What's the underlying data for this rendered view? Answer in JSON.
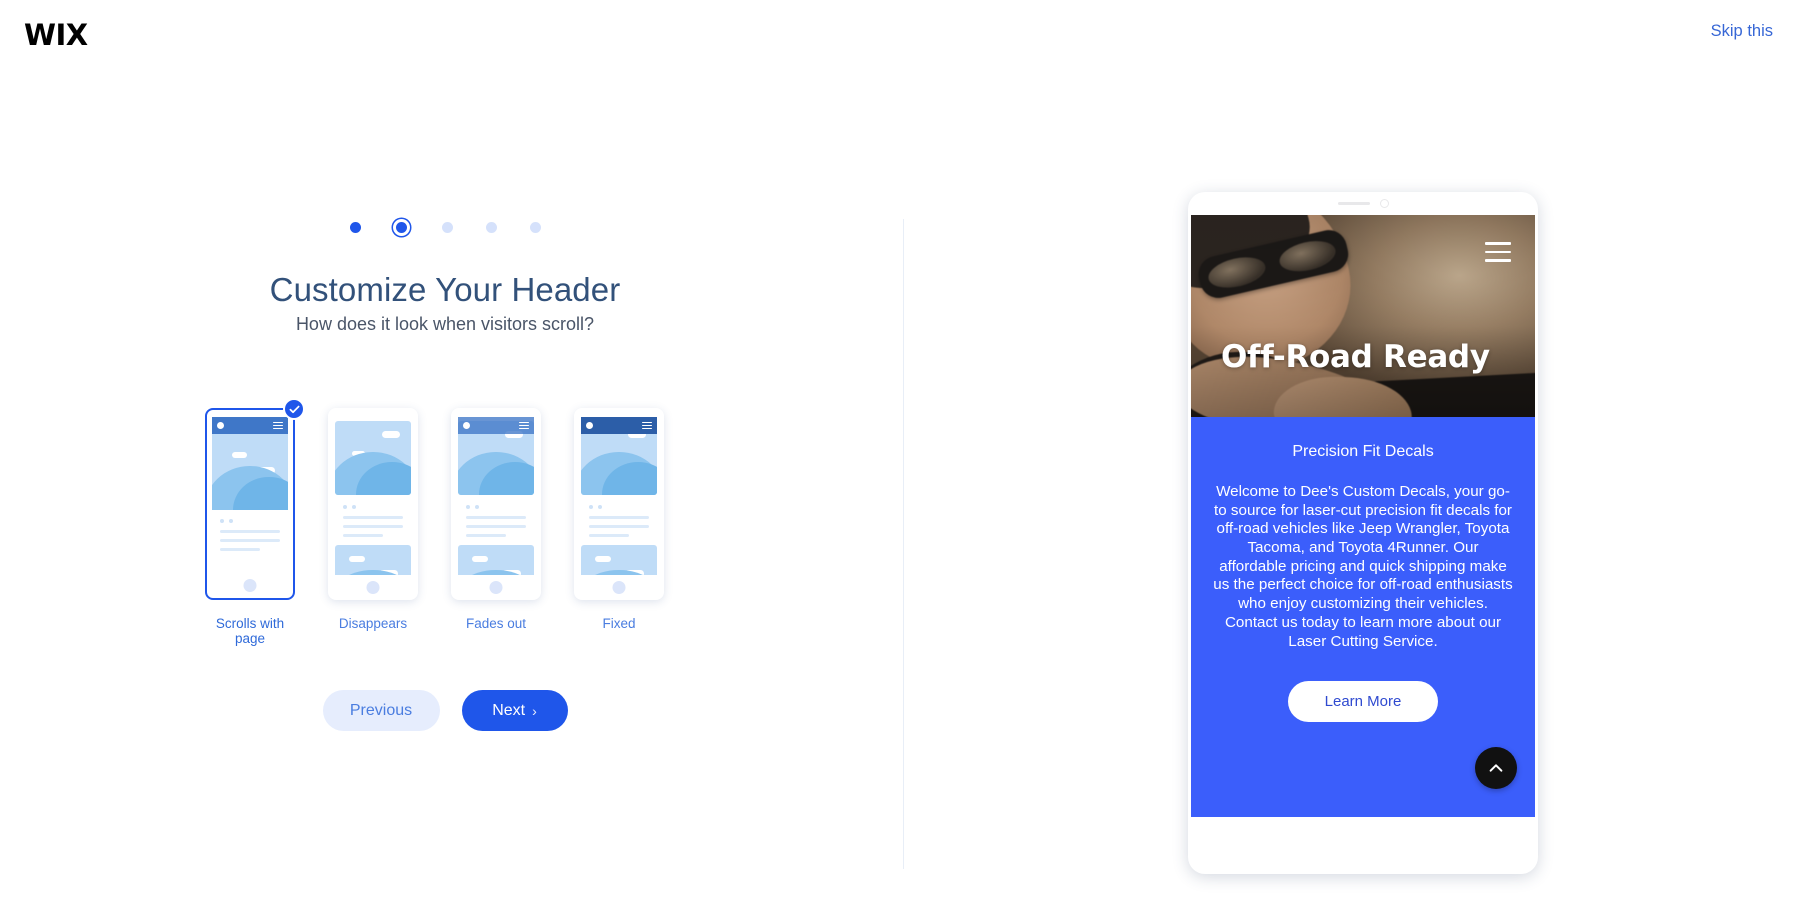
{
  "topbar": {
    "logo": "WIX",
    "skip_label": "Skip this"
  },
  "wizard": {
    "step_dots": [
      {
        "state": "done"
      },
      {
        "state": "current"
      },
      {
        "state": "upcoming"
      },
      {
        "state": "upcoming"
      },
      {
        "state": "upcoming"
      }
    ],
    "title": "Customize Your Header",
    "subtitle": "How does it look when visitors scroll?",
    "options": [
      {
        "label": "Scrolls with page",
        "selected": true,
        "header_style": "scrolls"
      },
      {
        "label": "Disappears",
        "selected": false,
        "header_style": "none"
      },
      {
        "label": "Fades out",
        "selected": false,
        "header_style": "fades"
      },
      {
        "label": "Fixed",
        "selected": false,
        "header_style": "fixed"
      }
    ],
    "previous_label": "Previous",
    "next_label": "Next",
    "next_chevron": "›"
  },
  "preview": {
    "hero_title": "Off-Road Ready",
    "menu_icon": "hamburger-menu-icon",
    "section_title": "Precision Fit Decals",
    "section_body": "Welcome to Dee's Custom Decals, your go-to source for laser-cut precision fit decals for off-road vehicles like Jeep Wrangler, Toyota Tacoma, and Toyota 4Runner. Our affordable pricing and quick shipping make us the perfect choice for off-road enthusiasts who enjoy customizing their vehicles. Contact us today to learn more about our Laser Cutting Service.",
    "learn_more_label": "Learn More",
    "scroll_top_icon": "chevron-up-icon"
  },
  "colors": {
    "accent_blue": "#1f56ea",
    "link_blue": "#3767d6",
    "preview_blue": "#3b5efb",
    "title_slate": "#32517a",
    "soft_blue": "#e6edfd"
  }
}
